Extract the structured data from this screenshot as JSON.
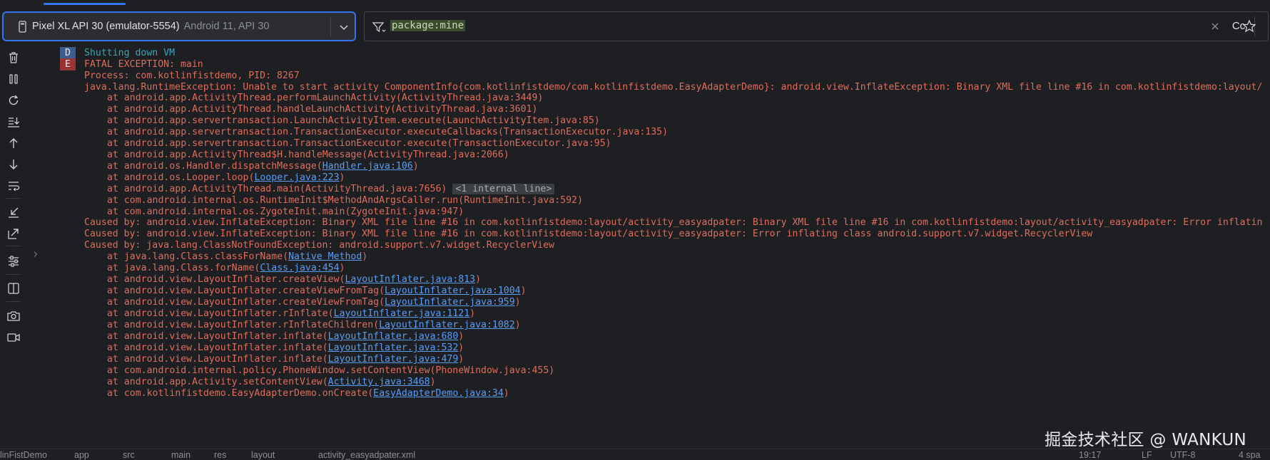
{
  "device": {
    "name": "Pixel XL API 30 (emulator-5554)",
    "api": "Android 11, API 30"
  },
  "filter": {
    "query": "package:mine",
    "match_case_label": "Cc"
  },
  "toolbar": {
    "icons": [
      "trash-icon",
      "pause-icon",
      "restart-icon",
      "scroll-to-end-icon",
      "arrow-up-icon",
      "arrow-down-icon",
      "soft-wrap-icon",
      "collapse-icon",
      "expand-icon",
      "settings-icon",
      "split-panels-icon",
      "camera-icon",
      "video-icon"
    ]
  },
  "log": {
    "line_d": "Shutting down VM",
    "tag_d": "D",
    "line_e": "FATAL EXCEPTION: main",
    "tag_e": "E",
    "lines": [
      "Process: com.kotlinfistdemo, PID: 8267",
      "java.lang.RuntimeException: Unable to start activity ComponentInfo{com.kotlinfistdemo/com.kotlinfistdemo.EasyAdapterDemo}: android.view.InflateException: Binary XML file line #16 in com.kotlinfistdemo:layout/"
    ],
    "frames_1": [
      "at android.app.ActivityThread.performLaunchActivity(ActivityThread.java:3449)",
      "at android.app.ActivityThread.handleLaunchActivity(ActivityThread.java:3601)",
      "at android.app.servertransaction.LaunchActivityItem.execute(LaunchActivityItem.java:85)",
      "at android.app.servertransaction.TransactionExecutor.executeCallbacks(TransactionExecutor.java:135)",
      "at android.app.servertransaction.TransactionExecutor.execute(TransactionExecutor.java:95)",
      "at android.app.ActivityThread$H.handleMessage(ActivityThread.java:2066)"
    ],
    "frame_handler_prefix": "at android.os.Handler.dispatchMessage(",
    "frame_handler_link": "Handler.java:106",
    "frame_looper_prefix": "at android.os.Looper.loop(",
    "frame_looper_link": "Looper.java:223",
    "frame_main": "at android.app.ActivityThread.main(ActivityThread.java:7656)",
    "internal_line": "<1 internal line>",
    "frames_2": [
      "at com.android.internal.os.RuntimeInit$MethodAndArgsCaller.run(RuntimeInit.java:592)",
      "at com.android.internal.os.ZygoteInit.main(ZygoteInit.java:947)"
    ],
    "caused_by": [
      "Caused by: android.view.InflateException: Binary XML file line #16 in com.kotlinfistdemo:layout/activity_easyadpater: Binary XML file line #16 in com.kotlinfistdemo:layout/activity_easyadpater: Error inflatin",
      "Caused by: android.view.InflateException: Binary XML file line #16 in com.kotlinfistdemo:layout/activity_easyadpater: Error inflating class android.support.v7.widget.RecyclerView",
      "Caused by: java.lang.ClassNotFoundException: android.support.v7.widget.RecyclerView"
    ],
    "linked_frames": [
      {
        "prefix": "at java.lang.Class.classForName(",
        "link": "Native Method"
      },
      {
        "prefix": "at java.lang.Class.forName(",
        "link": "Class.java:454"
      },
      {
        "prefix": "at android.view.LayoutInflater.createView(",
        "link": "LayoutInflater.java:813"
      },
      {
        "prefix": "at android.view.LayoutInflater.createViewFromTag(",
        "link": "LayoutInflater.java:1004"
      },
      {
        "prefix": "at android.view.LayoutInflater.createViewFromTag(",
        "link": "LayoutInflater.java:959"
      },
      {
        "prefix": "at android.view.LayoutInflater.rInflate(",
        "link": "LayoutInflater.java:1121"
      },
      {
        "prefix": "at android.view.LayoutInflater.rInflateChildren(",
        "link": "LayoutInflater.java:1082"
      },
      {
        "prefix": "at android.view.LayoutInflater.inflate(",
        "link": "LayoutInflater.java:680"
      },
      {
        "prefix": "at android.view.LayoutInflater.inflate(",
        "link": "LayoutInflater.java:532"
      },
      {
        "prefix": "at android.view.LayoutInflater.inflate(",
        "link": "LayoutInflater.java:479"
      }
    ],
    "frame_phonewindow": "at com.android.internal.policy.PhoneWindow.setContentView(PhoneWindow.java:455)",
    "frame_activity_prefix": "at android.app.Activity.setContentView(",
    "frame_activity_link": "Activity.java:3468",
    "frame_oncreate_prefix": "at com.kotlinfistdemo.EasyAdapterDemo.onCreate(",
    "frame_oncreate_link": "EasyAdapterDemo.java:34"
  },
  "watermark": "掘金技术社区 @ WANKUN",
  "statusbar": {
    "crumbs": [
      "linFistDemo",
      "app",
      "src",
      "main",
      "res",
      "layout",
      "activity_easyadpater.xml"
    ],
    "time": "19:17",
    "line_sep": "LF",
    "encoding": "UTF-8",
    "indent": "4 spa"
  },
  "colors": {
    "accent": "#3574f0",
    "error": "#e06c5b",
    "debug": "#39a6b6",
    "link": "#589df6"
  }
}
